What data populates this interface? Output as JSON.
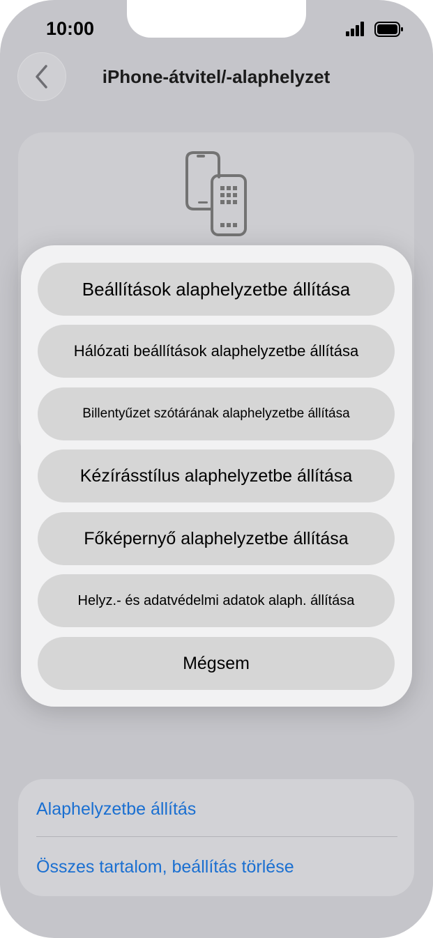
{
  "status_bar": {
    "time": "10:00"
  },
  "nav": {
    "title": "iPhone-átvitel/-alaphelyzet"
  },
  "sheet": {
    "options": [
      {
        "label": "Beállítások alaphelyzetbe állítása"
      },
      {
        "label": "Hálózati beállítások alaphelyzetbe állítása"
      },
      {
        "label": "Billentyűzet szótárának alaphelyzetbe állítása"
      },
      {
        "label": "Kézírásstílus alaphelyzetbe állítása"
      },
      {
        "label": "Főképernyő alaphelyzetbe állítása"
      },
      {
        "label": "Helyz.- és adatvédelmi adatok alaph. állítása"
      }
    ],
    "cancel_label": "Mégsem"
  },
  "bottom_list": {
    "reset_label": "Alaphelyzetbe állítás",
    "erase_label": "Összes tartalom, beállítás törlése"
  },
  "colors": {
    "link": "#1a6fd1",
    "background_dimmed": "#c5c5ca",
    "sheet_background": "#f2f2f3",
    "button_fill": "#d6d6d6"
  },
  "icons": {
    "back": "chevron-left-icon",
    "transfer": "phone-transfer-icon",
    "signal": "cellular-signal-icon",
    "battery": "battery-icon"
  }
}
